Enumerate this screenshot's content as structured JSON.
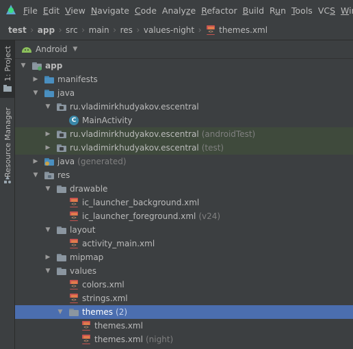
{
  "menu": [
    "File",
    "Edit",
    "View",
    "Navigate",
    "Code",
    "Analyze",
    "Refactor",
    "Build",
    "Run",
    "Tools",
    "VCS",
    "Window"
  ],
  "menu_mnemonics": [
    "F",
    "E",
    "V",
    "N",
    "C",
    "z",
    "R",
    "B",
    "u",
    "T",
    "S",
    "W"
  ],
  "breadcrumb": [
    "test",
    "app",
    "src",
    "main",
    "res",
    "values-night",
    "themes.xml"
  ],
  "sidebar": {
    "project_tab": "1: Project",
    "resource_tab": "Resource Manager"
  },
  "panel": {
    "view_mode": "Android",
    "dropdown_glyph": "▼"
  },
  "tree": [
    {
      "label": "app",
      "bold": true,
      "suffix": "",
      "icon": "app-module-icon",
      "expanded": true,
      "depth": 0
    },
    {
      "label": "manifests",
      "suffix": "",
      "icon": "folder-icon",
      "expanded": false,
      "depth": 1
    },
    {
      "label": "java",
      "suffix": "",
      "icon": "folder-icon",
      "expanded": true,
      "depth": 1
    },
    {
      "label": "ru.vladimirkhudyakov.escentral",
      "suffix": "",
      "icon": "package-icon",
      "expanded": true,
      "depth": 2
    },
    {
      "label": "MainActivity",
      "suffix": "",
      "icon": "class-icon",
      "leaf": true,
      "depth": 3
    },
    {
      "label": "ru.vladimirkhudyakov.escentral",
      "suffix": "(androidTest)",
      "icon": "package-icon",
      "expanded": false,
      "depth": 2,
      "highlight": "green"
    },
    {
      "label": "ru.vladimirkhudyakov.escentral",
      "suffix": "(test)",
      "icon": "package-icon",
      "expanded": false,
      "depth": 2,
      "highlight": "green"
    },
    {
      "label": "java",
      "suffix": "(generated)",
      "icon": "generated-folder-icon",
      "expanded": false,
      "depth": 1
    },
    {
      "label": "res",
      "suffix": "",
      "icon": "res-folder-icon",
      "expanded": true,
      "depth": 1
    },
    {
      "label": "drawable",
      "suffix": "",
      "icon": "folder-icon",
      "expanded": true,
      "depth": 2
    },
    {
      "label": "ic_launcher_background.xml",
      "suffix": "",
      "icon": "xml-file-icon",
      "leaf": true,
      "depth": 3
    },
    {
      "label": "ic_launcher_foreground.xml",
      "suffix": "(v24)",
      "icon": "xml-file-icon",
      "leaf": true,
      "depth": 3
    },
    {
      "label": "layout",
      "suffix": "",
      "icon": "folder-icon",
      "expanded": true,
      "depth": 2
    },
    {
      "label": "activity_main.xml",
      "suffix": "",
      "icon": "xml-file-icon",
      "leaf": true,
      "depth": 3
    },
    {
      "label": "mipmap",
      "suffix": "",
      "icon": "folder-icon",
      "expanded": false,
      "depth": 2
    },
    {
      "label": "values",
      "suffix": "",
      "icon": "folder-icon",
      "expanded": true,
      "depth": 2
    },
    {
      "label": "colors.xml",
      "suffix": "",
      "icon": "xml-file-icon",
      "leaf": true,
      "depth": 3
    },
    {
      "label": "strings.xml",
      "suffix": "",
      "icon": "xml-file-icon",
      "leaf": true,
      "depth": 3
    },
    {
      "label": "themes",
      "suffix": "(2)",
      "icon": "folder-icon",
      "expanded": true,
      "depth": 3,
      "highlight": "selected"
    },
    {
      "label": "themes.xml",
      "suffix": "",
      "icon": "xml-file-icon",
      "leaf": true,
      "depth": 4
    },
    {
      "label": "themes.xml",
      "suffix": "(night)",
      "icon": "xml-file-icon",
      "leaf": true,
      "depth": 4
    }
  ],
  "colors": {
    "background": "#3c3f41",
    "selection": "#4b6eaf",
    "test_highlight": "#3f4a3c",
    "android_green": "#8bbf5b"
  }
}
